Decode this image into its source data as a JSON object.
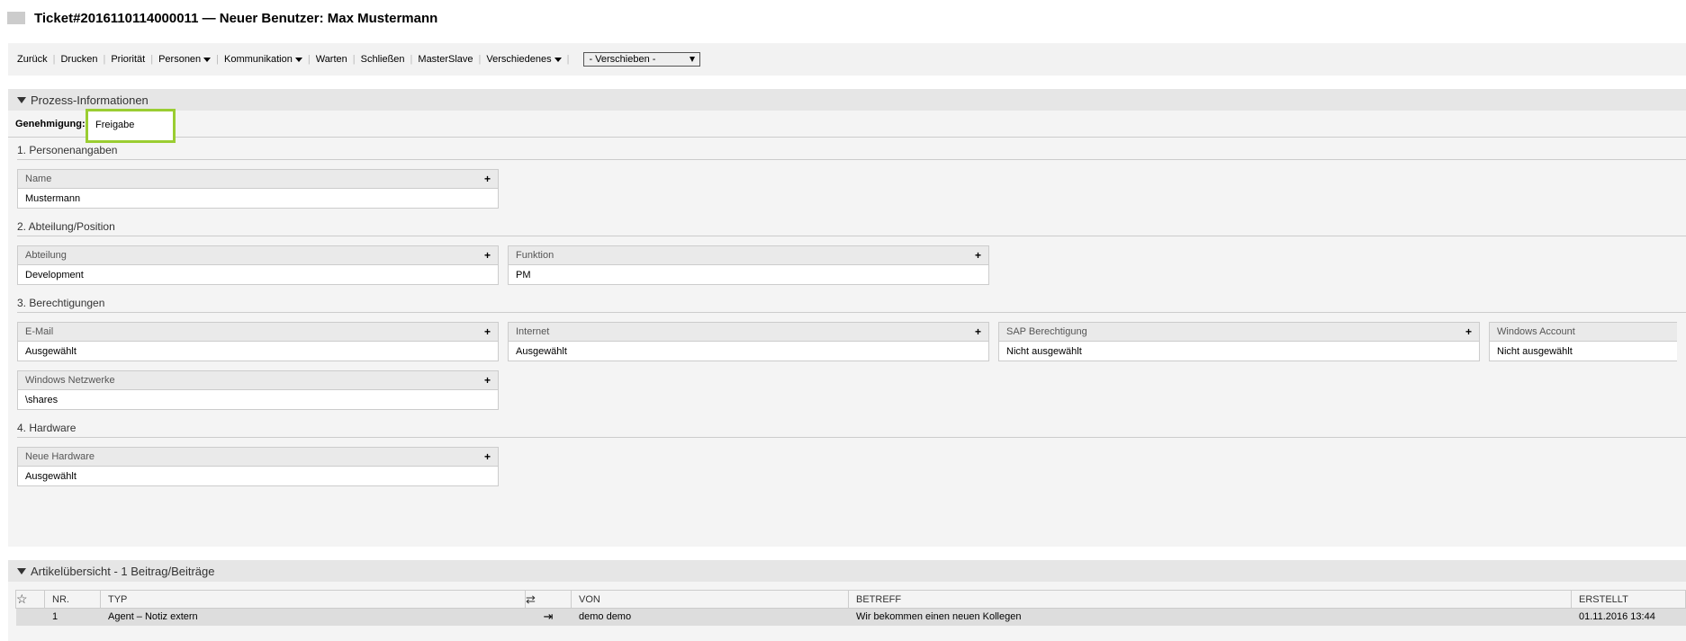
{
  "header": {
    "title": "Ticket#2016110114000011 — Neuer Benutzer: Max Mustermann"
  },
  "actions": {
    "items": [
      "Zurück",
      "Drucken",
      "Priorität",
      "Personen",
      "Kommunikation",
      "Warten",
      "Schließen",
      "MasterSlave",
      "Verschiedenes"
    ],
    "move_label": "- Verschieben -"
  },
  "process": {
    "title": "Prozess-Informationen",
    "approval_label": "Genehmigung:",
    "approval_value": "Freigabe",
    "sections": [
      {
        "title": "1. Personenangaben",
        "fields": [
          {
            "label": "Name",
            "value": "Mustermann"
          }
        ]
      },
      {
        "title": "2. Abteilung/Position",
        "fields": [
          {
            "label": "Abteilung",
            "value": "Development"
          },
          {
            "label": "Funktion",
            "value": "PM"
          }
        ]
      },
      {
        "title": "3. Berechtigungen",
        "fields": [
          {
            "label": "E-Mail",
            "value": "Ausgewählt"
          },
          {
            "label": "Internet",
            "value": "Ausgewählt"
          },
          {
            "label": "SAP Berechtigung",
            "value": "Nicht ausgewählt"
          },
          {
            "label": "Windows Account",
            "value": "Nicht ausgewählt"
          },
          {
            "label": "Windows Netzwerke",
            "value": "\\shares"
          }
        ]
      },
      {
        "title": "4. Hardware",
        "fields": [
          {
            "label": "Neue Hardware",
            "value": "Ausgewählt"
          }
        ]
      }
    ]
  },
  "articles": {
    "title": "Artikelübersicht - 1 Beitrag/Beiträge",
    "columns": {
      "nr": "NR.",
      "typ": "TYP",
      "von": "VON",
      "betreff": "BETREFF",
      "erstellt": "ERSTELLT"
    },
    "rows": [
      {
        "nr": "1",
        "typ": "Agent – Notiz extern",
        "von": "demo demo",
        "betreff": "Wir bekommen einen neuen Kollegen",
        "erstellt": "01.11.2016 13:44"
      }
    ]
  }
}
